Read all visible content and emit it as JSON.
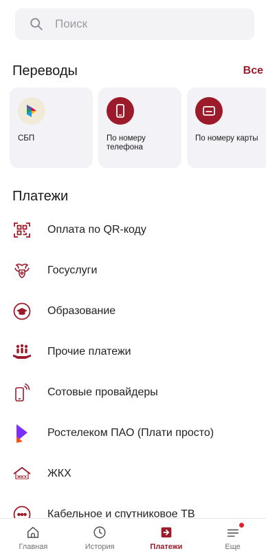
{
  "search": {
    "placeholder": "Поиск",
    "icon": "search-icon"
  },
  "transfers": {
    "title": "Переводы",
    "all_label": "Все",
    "items": [
      {
        "label": "СБП",
        "icon": "sbp-logo-icon"
      },
      {
        "label": "По номеру телефона",
        "icon": "phone-icon"
      },
      {
        "label": "По номеру карты",
        "icon": "card-icon"
      }
    ]
  },
  "payments": {
    "title": "Платежи",
    "items": [
      {
        "label": "Оплата по QR-коду",
        "icon": "qr-scan-icon"
      },
      {
        "label": "Госуслуги",
        "icon": "coat-of-arms-icon"
      },
      {
        "label": "Образование",
        "icon": "graduation-cap-icon"
      },
      {
        "label": "Прочие платежи",
        "icon": "people-hand-icon"
      },
      {
        "label": "Сотовые провайдеры",
        "icon": "mobile-signal-icon"
      },
      {
        "label": "Ростелеком ПАО (Плати просто)",
        "icon": "rostelecom-logo-icon"
      },
      {
        "label": "ЖКХ",
        "icon": "house-icon"
      },
      {
        "label": "Кабельное и спутниковое ТВ",
        "icon": "tv-icon"
      }
    ]
  },
  "tabbar": {
    "items": [
      {
        "label": "Главная",
        "icon": "home-icon"
      },
      {
        "label": "История",
        "icon": "clock-icon"
      },
      {
        "label": "Платежи",
        "icon": "payments-icon",
        "active": true
      },
      {
        "label": "Еще",
        "icon": "menu-icon",
        "badge": true
      }
    ]
  },
  "colors": {
    "accent": "#9b1b2a",
    "card_bg": "#f3f3f7",
    "badge": "#e0202b"
  }
}
